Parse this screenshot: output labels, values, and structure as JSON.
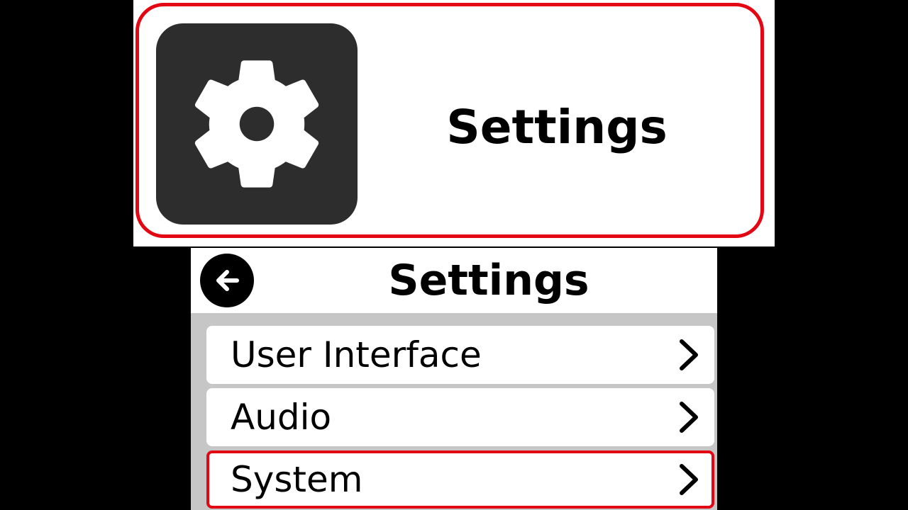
{
  "app_tile": {
    "icon": "gear-icon",
    "title": "Settings",
    "highlight_color": "#e30613"
  },
  "settings_screen": {
    "back_icon": "arrow-left-icon",
    "title": "Settings",
    "items": [
      {
        "label": "User Interface",
        "icon": "chevron-right-icon",
        "selected": false
      },
      {
        "label": "Audio",
        "icon": "chevron-right-icon",
        "selected": false
      },
      {
        "label": "System",
        "icon": "chevron-right-icon",
        "selected": true
      }
    ],
    "selection_color": "#e30613"
  }
}
